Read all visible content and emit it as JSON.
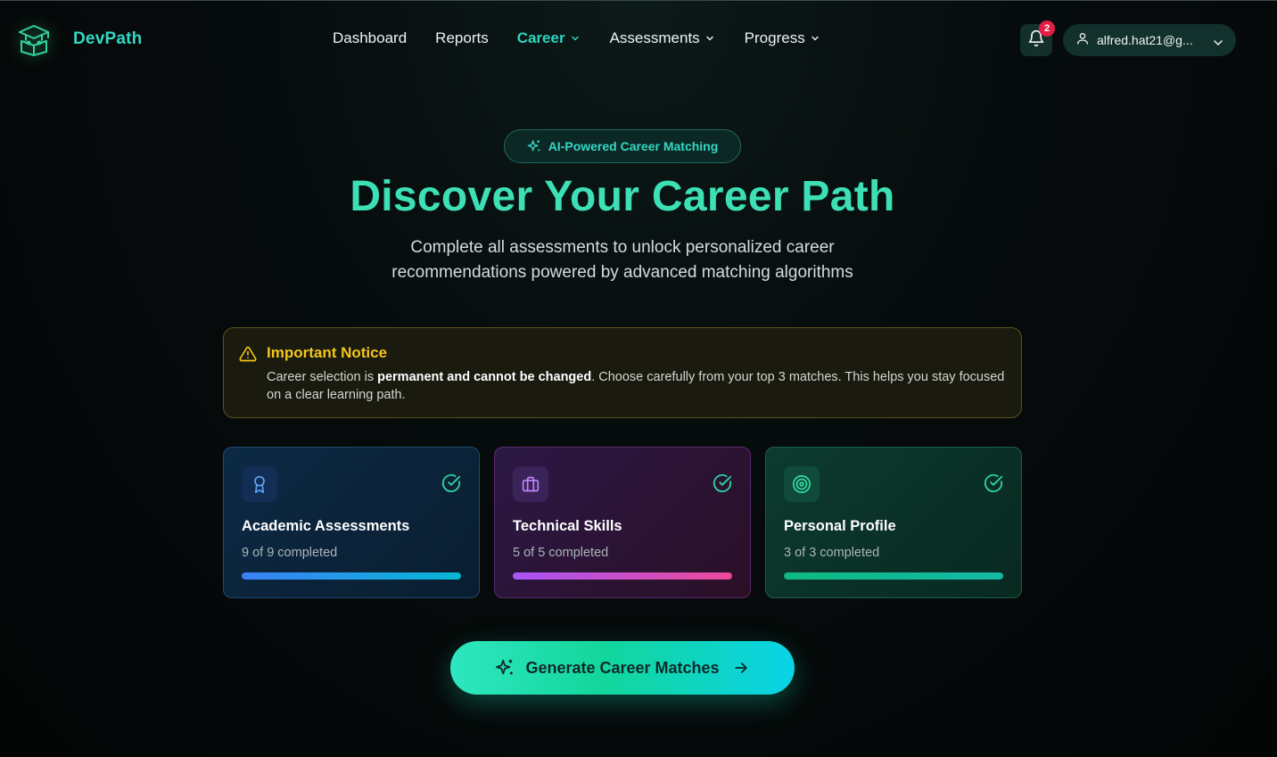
{
  "brand": {
    "name": "DevPath"
  },
  "nav": [
    {
      "label": "Dashboard",
      "dropdown": false,
      "active": false
    },
    {
      "label": "Reports",
      "dropdown": false,
      "active": false
    },
    {
      "label": "Career",
      "dropdown": true,
      "active": true
    },
    {
      "label": "Assessments",
      "dropdown": true,
      "active": false
    },
    {
      "label": "Progress",
      "dropdown": true,
      "active": false
    }
  ],
  "notifications": {
    "count": "2"
  },
  "user": {
    "email": "alfred.hat21@g..."
  },
  "hero": {
    "badge": "AI-Powered Career Matching",
    "title": "Discover Your Career Path",
    "subtitle": "Complete all assessments to unlock personalized career recommendations powered by advanced matching algorithms"
  },
  "notice": {
    "title": "Important Notice",
    "body_pre": "Career selection is ",
    "body_bold": "permanent and cannot be changed",
    "body_post": ". Choose carefully from your top 3 matches. This helps you stay focused on a clear learning path."
  },
  "cards": [
    {
      "title": "Academic Assessments",
      "status": "9 of 9 completed",
      "progress": 1.0,
      "icon": "award-icon"
    },
    {
      "title": "Technical Skills",
      "status": "5 of 5 completed",
      "progress": 1.0,
      "icon": "briefcase-icon"
    },
    {
      "title": "Personal Profile",
      "status": "3 of 3 completed",
      "progress": 1.0,
      "icon": "target-icon"
    }
  ],
  "cta": {
    "label": "Generate Career Matches"
  },
  "colors": {
    "accent": "#2dd4bf",
    "notice": "#f5c518",
    "badge": "#e11d48"
  }
}
